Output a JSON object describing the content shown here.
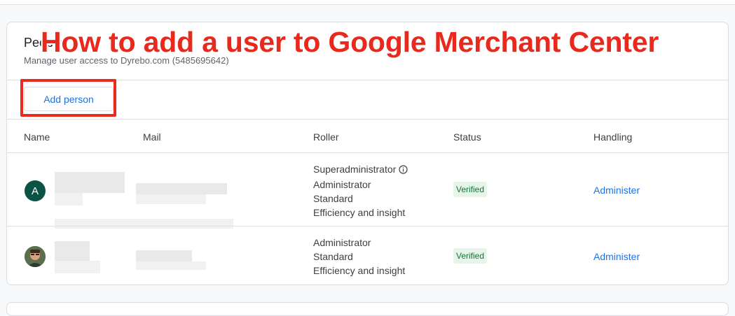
{
  "overlay": {
    "headline": "How to add a user to Google Merchant Center"
  },
  "card": {
    "title": "People",
    "subtitle": "Manage user access to Dyrebo.com (5485695642)",
    "add_button_label": "Add person"
  },
  "table": {
    "columns": [
      "Name",
      "Mail",
      "Roller",
      "Status",
      "Handling"
    ],
    "rows": [
      {
        "avatar_letter": "A",
        "roles": [
          "Superadministrator",
          "Administrator",
          "Standard",
          "Efficiency and insight"
        ],
        "status": "Verified",
        "action": "Administer"
      },
      {
        "avatar_letter": "",
        "roles": [
          "Administrator",
          "Standard",
          "Efficiency and insight"
        ],
        "status": "Verified",
        "action": "Administer"
      }
    ]
  },
  "colors": {
    "accent": "#1a73e8",
    "highlight": "#ea2a1d",
    "verified_bg": "#e6f4ea",
    "verified_text": "#137333",
    "avatar_a": "#0b5345"
  }
}
